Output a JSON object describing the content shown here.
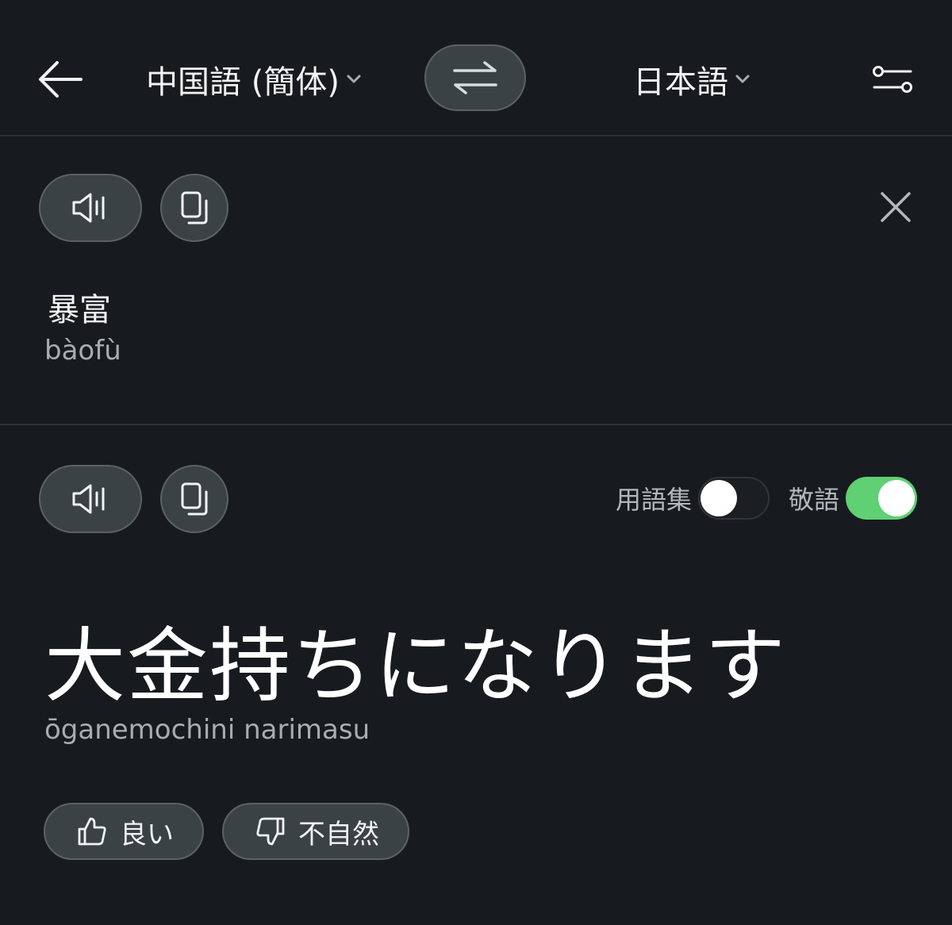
{
  "header": {
    "back_icon": "arrow-left-icon",
    "source_language": "中国語 (簡体)",
    "target_language": "日本語",
    "swap_icon": "swap-arrows-icon",
    "settings_icon": "sliders-icon"
  },
  "source": {
    "text": "暴富",
    "romanization": "bàofù",
    "speak_icon": "speaker-icon",
    "copy_icon": "copy-icon",
    "close_icon": "close-icon"
  },
  "translation": {
    "text": "大金持ちになります",
    "romanization": "ōganemochini narimasu",
    "speak_icon": "speaker-icon",
    "copy_icon": "copy-icon",
    "glossary": {
      "label": "用語集",
      "on": false
    },
    "honorific": {
      "label": "敬語",
      "on": true
    }
  },
  "feedback": {
    "good_label": "良い",
    "good_icon": "thumbs-up-icon",
    "unnatural_label": "不自然",
    "unnatural_icon": "thumbs-down-icon"
  },
  "colors": {
    "background": "#171b1f",
    "pill_background": "#3b4246",
    "toggle_on": "#5fd073"
  }
}
